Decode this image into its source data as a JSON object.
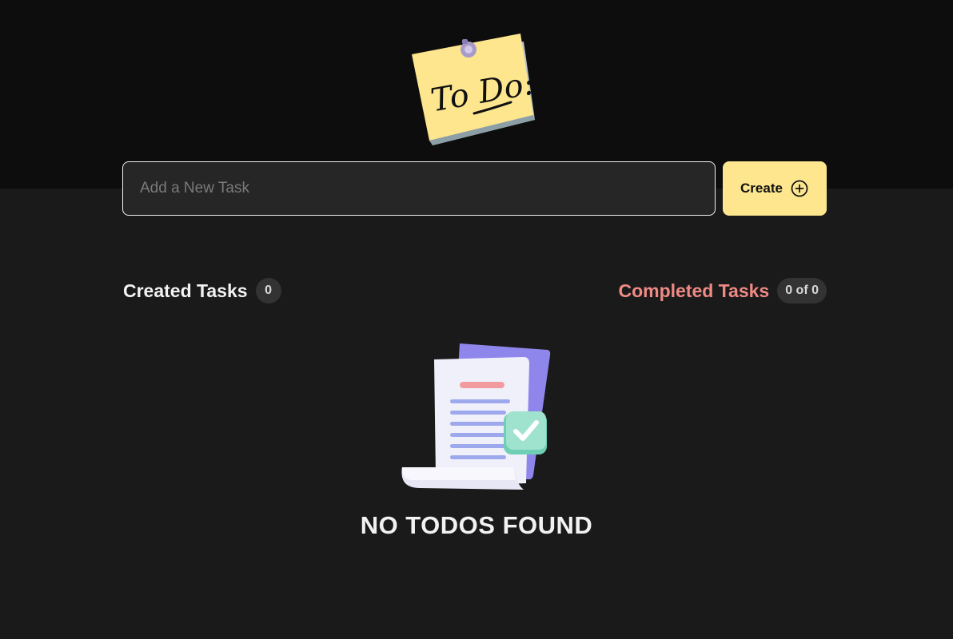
{
  "logo": {
    "text": "To Do:",
    "icon": "sticky-note-pin-icon"
  },
  "form": {
    "input_placeholder": "Add a New Task",
    "input_value": "",
    "create_label": "Create",
    "create_icon": "plus-circle-icon",
    "accent_color": "#fde68e"
  },
  "counters": {
    "created_label": "Created Tasks",
    "created_count": "0",
    "completed_label": "Completed Tasks",
    "completed_count": "0 of 0",
    "completed_color": "#f08a85"
  },
  "empty_state": {
    "icon": "document-checklist-icon",
    "message": "NO TODOS FOUND"
  }
}
